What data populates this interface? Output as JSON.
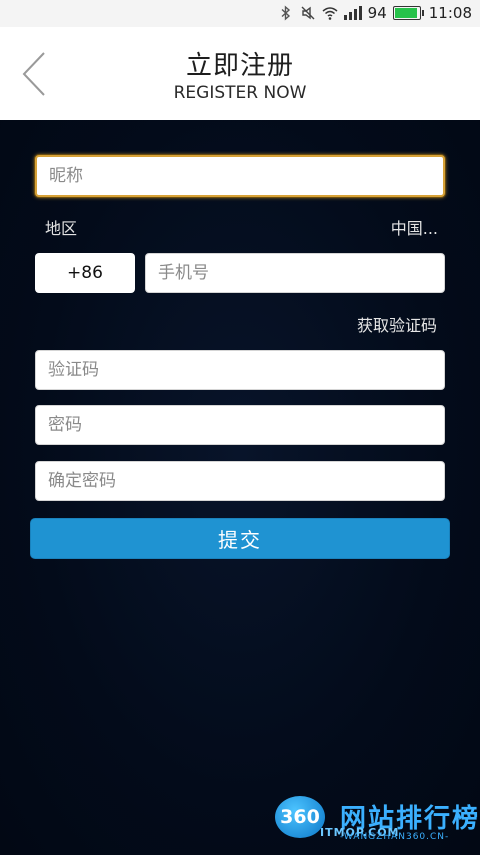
{
  "status_bar": {
    "battery_percent": "94",
    "battery_level": 0.94,
    "time": "11:08",
    "icons": [
      "bluetooth-icon",
      "mute-icon",
      "wifi-icon",
      "signal-icon",
      "battery-icon"
    ],
    "battery_color": "#26c24a"
  },
  "header": {
    "title": "立即注册",
    "subtitle": "REGISTER NOW",
    "back_icon": "chevron-left-icon"
  },
  "form": {
    "nickname_placeholder": "昵称",
    "region_label": "地区",
    "region_value": "中国...",
    "country_code": "+86",
    "phone_placeholder": "手机号",
    "get_code_label": "获取验证码",
    "code_placeholder": "验证码",
    "password_placeholder": "密码",
    "confirm_placeholder": "确定密码",
    "submit_label": "提交"
  },
  "colors": {
    "background": "#020a18",
    "accent": "#1f93d2",
    "focus_border": "#d8a237"
  },
  "watermark": {
    "badge": "360",
    "title": "网站排行榜",
    "small": "ITMOP.COM",
    "url": "-WANGZHAN360.CN-"
  }
}
